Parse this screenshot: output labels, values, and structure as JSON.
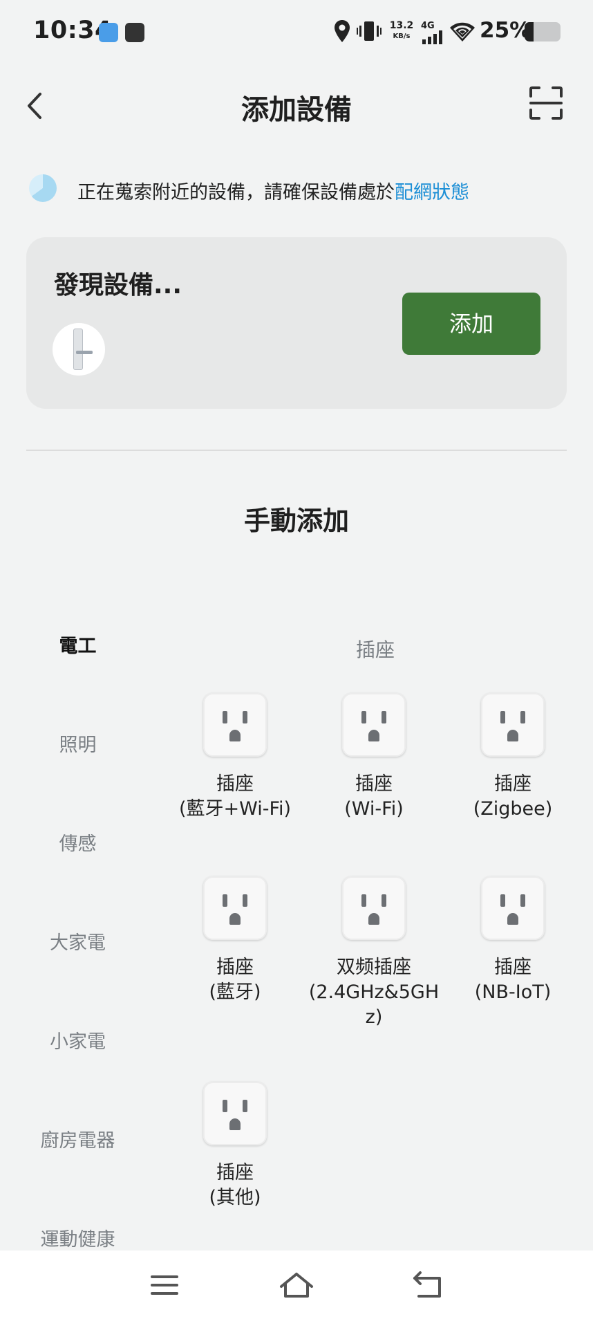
{
  "status_bar": {
    "time": "10:34",
    "net_speed_value": "13.2",
    "net_speed_unit": "KB/s",
    "network_type": "4G",
    "battery_percent": "25%",
    "battery_level": 0.25
  },
  "header": {
    "title": "添加設備"
  },
  "notice": {
    "text": "正在蒐索附近的設備，請確保設備處於",
    "link": "配網狀態"
  },
  "discover": {
    "title": "發現設備...",
    "add_label": "添加"
  },
  "manual": {
    "title": "手動添加"
  },
  "categories": [
    "電工",
    "照明",
    "傳感",
    "大家電",
    "小家電",
    "廚房電器",
    "運動健康"
  ],
  "active_category": "電工",
  "section": {
    "label": "插座"
  },
  "devices": [
    {
      "label": "插座\n(藍牙+Wi-Fi)",
      "icon": "socket-icon"
    },
    {
      "label": "插座\n(Wi-Fi)",
      "icon": "socket-icon"
    },
    {
      "label": "插座\n(Zigbee)",
      "icon": "socket-icon"
    },
    {
      "label": "插座\n(藍牙)",
      "icon": "socket-icon"
    },
    {
      "label": "双频插座\n(2.4GHz&5GH\nz)",
      "icon": "socket-icon"
    },
    {
      "label": "插座\n(NB-IoT)",
      "icon": "socket-icon"
    },
    {
      "label": "插座\n(其他)",
      "icon": "socket-icon"
    }
  ],
  "colors": {
    "accent_green": "#3f7a38",
    "link_blue": "#1d8fd6",
    "background": "#f2f3f3"
  }
}
